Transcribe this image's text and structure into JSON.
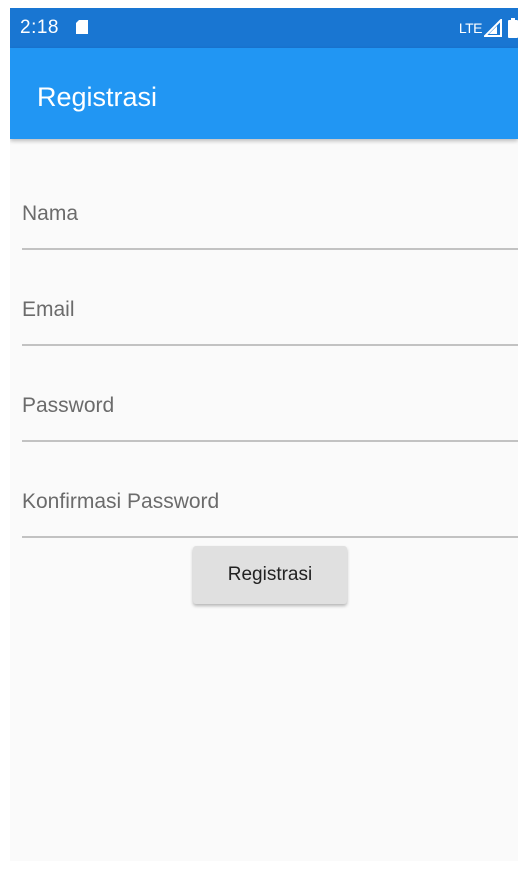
{
  "status_bar": {
    "time": "2:18",
    "network": "LTE",
    "icons": [
      "sd-card-icon",
      "signal-icon",
      "battery-icon"
    ],
    "color": "#1976d2"
  },
  "app_bar": {
    "title": "Registrasi",
    "color": "#2196f3"
  },
  "form": {
    "fields": [
      {
        "placeholder": "Nama",
        "value": ""
      },
      {
        "placeholder": "Email",
        "value": ""
      },
      {
        "placeholder": "Password",
        "value": ""
      },
      {
        "placeholder": "Konfirmasi Password",
        "value": ""
      }
    ],
    "submit_label": "Registrasi"
  }
}
